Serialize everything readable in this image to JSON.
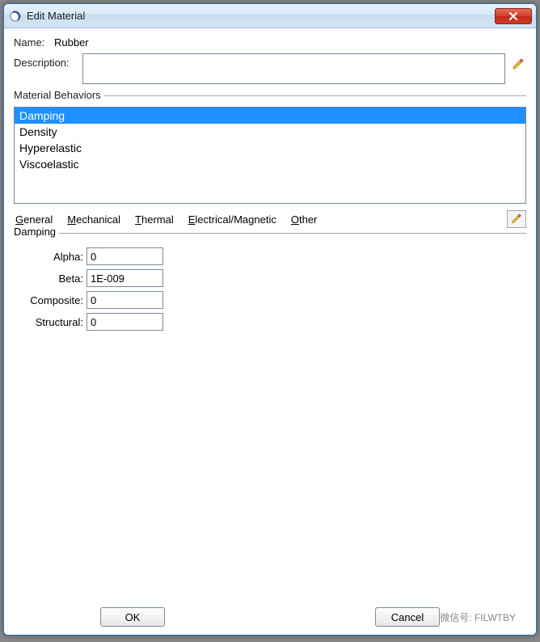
{
  "window": {
    "title": "Edit Material"
  },
  "name": {
    "label": "Name:",
    "value": "Rubber"
  },
  "description": {
    "label": "Description:",
    "value": ""
  },
  "behaviors": {
    "legend": "Material Behaviors",
    "items": [
      "Damping",
      "Density",
      "Hyperelastic",
      "Viscoelastic"
    ],
    "selected_index": 0
  },
  "menus": {
    "general": "General",
    "mechanical": "Mechanical",
    "thermal": "Thermal",
    "em": "Electrical/Magnetic",
    "other": "Other"
  },
  "section": {
    "title": "Damping",
    "params": [
      {
        "label": "Alpha:",
        "value": "0"
      },
      {
        "label": "Beta:",
        "value": "1E-009"
      },
      {
        "label": "Composite:",
        "value": "0"
      },
      {
        "label": "Structural:",
        "value": "0"
      }
    ]
  },
  "buttons": {
    "ok": "OK",
    "cancel": "Cancel"
  },
  "watermark": "微信号: FILWTBY"
}
